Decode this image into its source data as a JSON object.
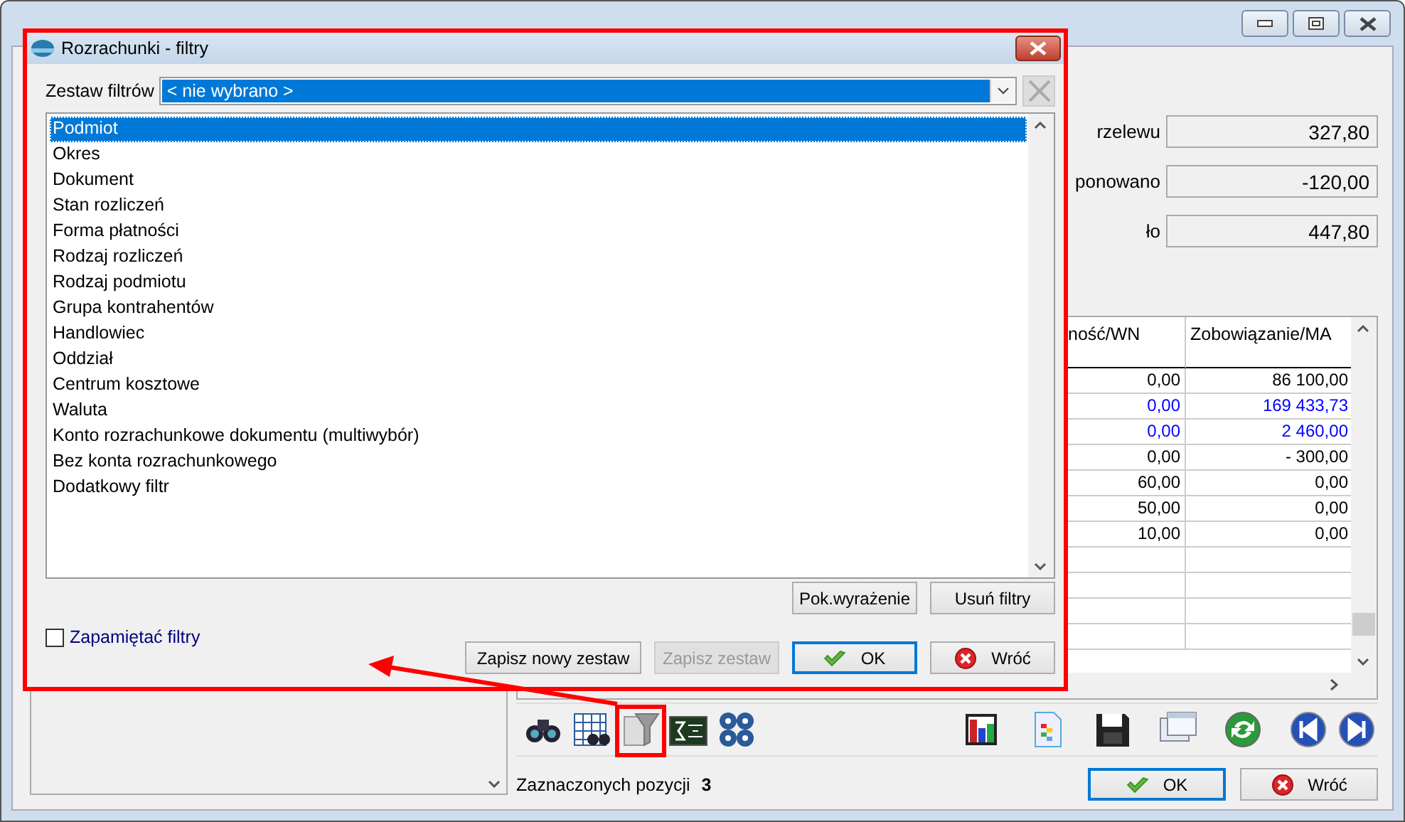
{
  "summary": [
    {
      "label": "rzelewu",
      "value": "327,80"
    },
    {
      "label": "ponowano",
      "value": "-120,00"
    },
    {
      "label": "ło",
      "value": "447,80"
    }
  ],
  "table": {
    "columns": [
      "ność/WN",
      "Zobowiązanie/MA"
    ],
    "rows": [
      {
        "cells": [
          "0,00",
          "86 100,00"
        ],
        "color": "#000000"
      },
      {
        "cells": [
          "0,00",
          "169 433,73"
        ],
        "color": "#0000ff"
      },
      {
        "cells": [
          "0,00",
          "2 460,00"
        ],
        "color": "#0000ff"
      },
      {
        "cells": [
          "0,00",
          "- 300,00"
        ],
        "color": "#000000"
      },
      {
        "cells": [
          "60,00",
          "0,00"
        ],
        "color": "#000000"
      },
      {
        "cells": [
          "50,00",
          "0,00"
        ],
        "color": "#000000"
      },
      {
        "cells": [
          "10,00",
          "0,00"
        ],
        "color": "#000000"
      }
    ]
  },
  "selection": {
    "label": "Zaznaczonych pozycji",
    "count": "3"
  },
  "buttons": [
    {
      "label": "OK",
      "kind": "ok",
      "default": true
    },
    {
      "label": "Wróć",
      "kind": "cancel",
      "default": false
    }
  ],
  "dialog": {
    "title": "Rozrachunki - filtry",
    "filter_set": {
      "label": "Zestaw filtrów",
      "value": "< nie wybrano >"
    },
    "filters": [
      {
        "label": "Podmiot",
        "selected": true
      },
      {
        "label": "Okres",
        "selected": false
      },
      {
        "label": "Dokument",
        "selected": false
      },
      {
        "label": "Stan rozliczeń",
        "selected": false
      },
      {
        "label": "Forma płatności",
        "selected": false
      },
      {
        "label": "Rodzaj rozliczeń",
        "selected": false
      },
      {
        "label": "Rodzaj podmiotu",
        "selected": false
      },
      {
        "label": "Grupa kontrahentów",
        "selected": false
      },
      {
        "label": "Handlowiec",
        "selected": false
      },
      {
        "label": "Oddział",
        "selected": false
      },
      {
        "label": "Centrum kosztowe",
        "selected": false
      },
      {
        "label": "Waluta",
        "selected": false
      },
      {
        "label": "Konto rozrachunkowe dokumentu (multiwybór)",
        "selected": false
      },
      {
        "label": "Bez konta rozrachunkowego",
        "selected": false
      },
      {
        "label": "Dodatkowy filtr",
        "selected": false
      }
    ],
    "list_buttons": [
      {
        "label": "Pok.wyrażenie"
      },
      {
        "label": "Usuń filtry"
      }
    ],
    "remember": {
      "label": "Zapamiętać filtry",
      "checked": false
    },
    "buttons": [
      {
        "label": "Zapisz nowy zestaw",
        "kind": "plain",
        "disabled": false,
        "default": false
      },
      {
        "label": "Zapisz zestaw",
        "kind": "plain",
        "disabled": true,
        "default": false
      },
      {
        "label": "OK",
        "kind": "ok",
        "disabled": false,
        "default": true
      },
      {
        "label": "Wróć",
        "kind": "cancel",
        "disabled": false,
        "default": false
      }
    ]
  }
}
